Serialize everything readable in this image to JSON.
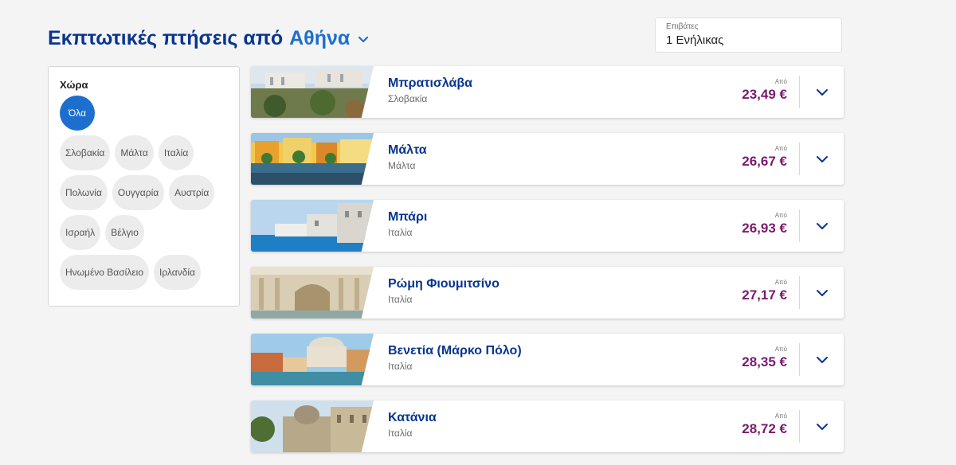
{
  "header": {
    "title_prefix": "Εκπτωτικές πτήσεις από",
    "origin_city": "Αθήνα",
    "dropdown_icon": "chevron-down-icon"
  },
  "passengers": {
    "label": "Επιβάτες",
    "value": "1 Ενήλικας"
  },
  "filter": {
    "heading": "Χώρα",
    "chips": [
      {
        "label": "Όλα",
        "active": true
      },
      {
        "label": "Σλοβακία"
      },
      {
        "label": "Μάλτα"
      },
      {
        "label": "Ιταλία"
      },
      {
        "label": "Πολωνία"
      },
      {
        "label": "Ουγγαρία"
      },
      {
        "label": "Αυστρία"
      },
      {
        "label": "Ισραήλ"
      },
      {
        "label": "Βέλγιο"
      },
      {
        "label": "Ηνωμένο Βασίλειο"
      },
      {
        "label": "Ιρλανδία"
      }
    ]
  },
  "results": [
    {
      "destination": "Μπρατισλάβα",
      "country": "Σλοβακία",
      "from_label": "Από",
      "price": "23,49 €",
      "photo": "bratislava-photo"
    },
    {
      "destination": "Μάλτα",
      "country": "Μάλτα",
      "from_label": "Από",
      "price": "26,67 €",
      "photo": "malta-photo"
    },
    {
      "destination": "Μπάρι",
      "country": "Ιταλία",
      "from_label": "Από",
      "price": "26,93 €",
      "photo": "bari-photo"
    },
    {
      "destination": "Ρώμη Φιουμιτσίνο",
      "country": "Ιταλία",
      "from_label": "Από",
      "price": "27,17 €",
      "photo": "rome-photo"
    },
    {
      "destination": "Βενετία (Μάρκο Πόλο)",
      "country": "Ιταλία",
      "from_label": "Από",
      "price": "28,35 €",
      "photo": "venice-photo"
    },
    {
      "destination": "Κατάνια",
      "country": "Ιταλία",
      "from_label": "Από",
      "price": "28,72 €",
      "photo": "catania-photo"
    }
  ],
  "colors": {
    "brand_blue": "#073590",
    "link_blue": "#1d6fcf",
    "price_purple": "#7a1a6e",
    "active_chip": "#1d6fcf"
  }
}
